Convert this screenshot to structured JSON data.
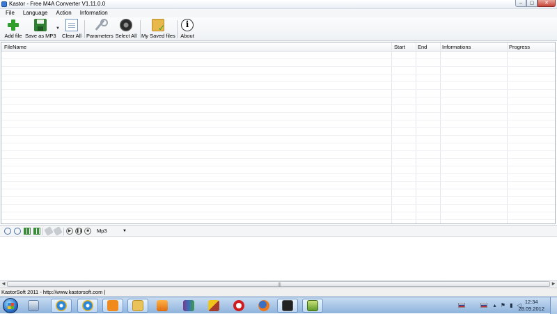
{
  "window": {
    "title": "Kastor - Free M4A Converter V1.11.0.0",
    "controls": {
      "minimize": "–",
      "maximize": "▢",
      "close": "✕"
    }
  },
  "menu": [
    "File",
    "Language",
    "Action",
    "Information"
  ],
  "toolbar": {
    "buttons": [
      {
        "label": "Add file",
        "icon": "add-icon"
      },
      {
        "label": "Save as MP3",
        "icon": "save-icon"
      },
      {
        "label": "Clear All",
        "icon": "document-icon"
      },
      {
        "label": "Parameters",
        "icon": "wrench-icon"
      },
      {
        "label": "Select All",
        "icon": "speaker-icon"
      },
      {
        "label": "My Saved files",
        "icon": "folder-icon"
      },
      {
        "label": "About",
        "icon": "info-icon"
      }
    ],
    "about_glyph": "i",
    "save_dropdown_glyph": "▼"
  },
  "grid": {
    "columns": [
      "FileName",
      "Start",
      "End",
      "Informations",
      "Progress"
    ],
    "rows": []
  },
  "player": {
    "format_selected": "Mp3",
    "format_arrow": "▼",
    "play_glyph": "▶",
    "pause_glyph": "❚❚",
    "stop_glyph": "■"
  },
  "scrollbar": {
    "left": "◀",
    "right": "▶",
    "grip": "|||"
  },
  "status": {
    "text": "KastorSoft 2011 - http://www.kastorsoft.com  |"
  },
  "taskbar": {
    "apps": [
      "explorer-icon",
      "ie-icon",
      "ie-icon",
      "odnoklassniki-icon",
      "folder-icon",
      "media-player-icon",
      "winrar-icon",
      "cursor-icon",
      "opera-icon",
      "firefox-icon",
      "aimp-icon",
      "kastor-icon"
    ],
    "clock_time": "12:34",
    "clock_date": "28.09.2012"
  },
  "colors": {
    "accent": "#2f9e2a",
    "taskbar": "#8eb3dc",
    "close_button": "#c7463a"
  }
}
